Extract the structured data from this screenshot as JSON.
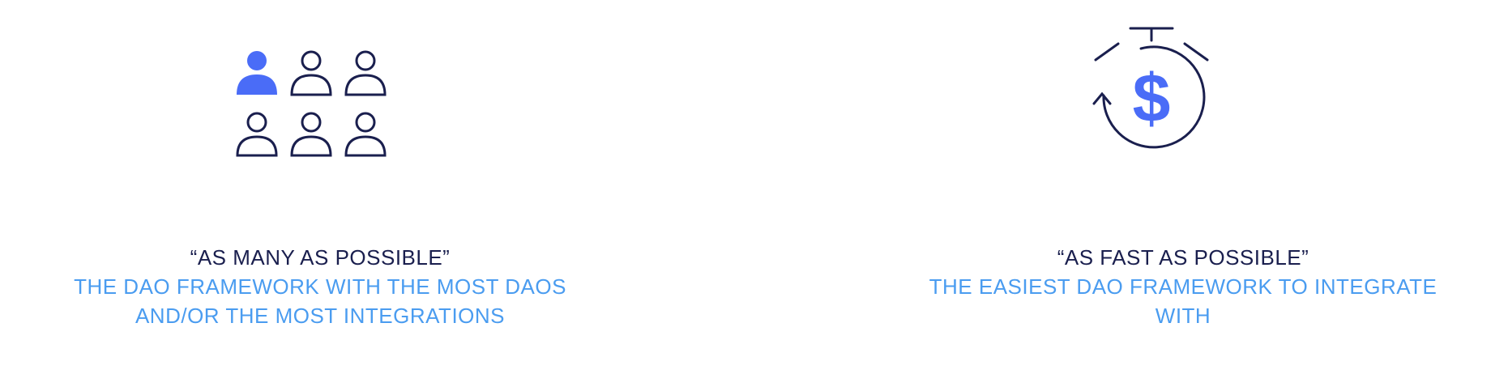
{
  "colors": {
    "navy": "#1a1f4e",
    "accent_blue": "#4a6cf7",
    "light_blue": "#4a9cf0"
  },
  "left": {
    "icon": "people-group-icon",
    "quote": "“AS MANY AS POSSIBLE”",
    "subtitle_line1": "THE DAO FRAMEWORK WITH THE MOST DAOS",
    "subtitle_line2": "AND/OR THE MOST INTEGRATIONS"
  },
  "right": {
    "icon": "stopwatch-dollar-icon",
    "quote": "“AS FAST AS POSSIBLE”",
    "subtitle_line1": "THE EASIEST DAO FRAMEWORK TO INTEGRATE",
    "subtitle_line2": "WITH"
  }
}
